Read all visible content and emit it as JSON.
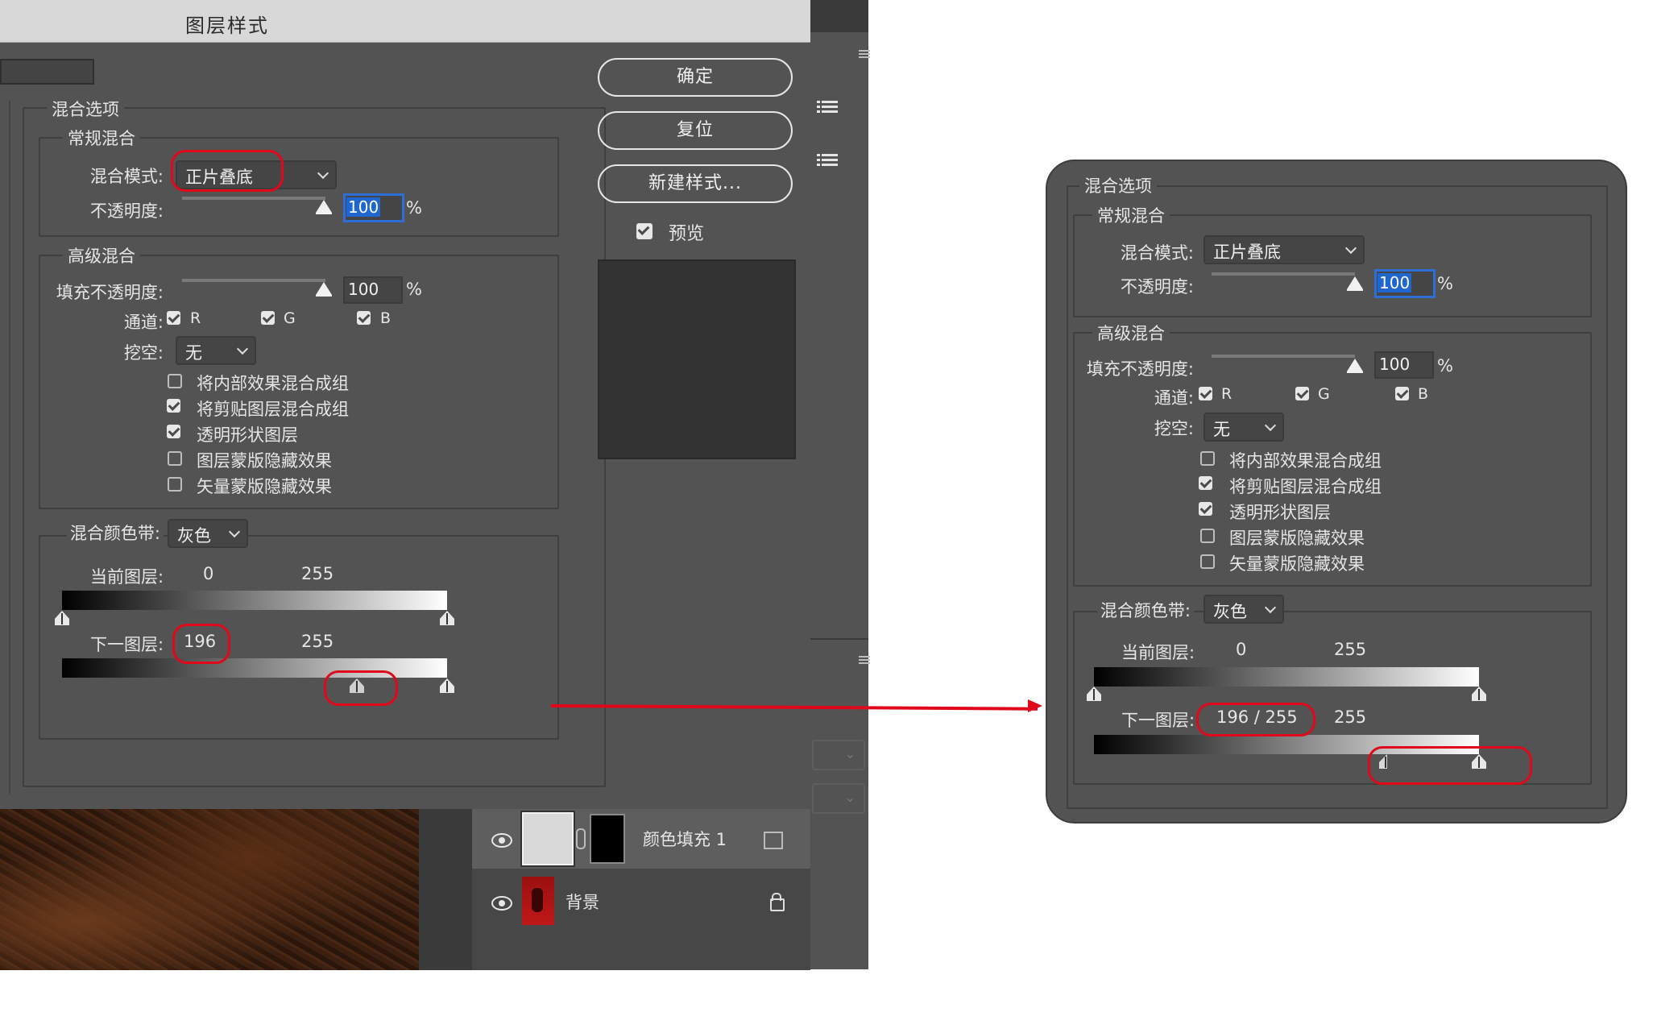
{
  "dialog": {
    "title": "图层样式",
    "buttons": {
      "ok": "确定",
      "reset": "复位",
      "new_style": "新建样式..."
    },
    "preview_label": "预览",
    "preview_checked": true
  },
  "blend_options": {
    "title": "混合选项",
    "general": {
      "title": "常规混合",
      "blend_mode_label": "混合模式:",
      "blend_mode": "正片叠底",
      "opacity_label": "不透明度:",
      "opacity": "100",
      "percent": "%"
    },
    "advanced": {
      "title": "高级混合",
      "fill_opacity_label": "填充不透明度:",
      "fill_opacity": "100",
      "percent": "%",
      "channels_label": "通道:",
      "channels": [
        "R",
        "G",
        "B"
      ],
      "knockout_label": "挖空:",
      "knockout": "无",
      "options": [
        {
          "label": "将内部效果混合成组",
          "checked": false
        },
        {
          "label": "将剪贴图层混合成组",
          "checked": true
        },
        {
          "label": "透明形状图层",
          "checked": true
        },
        {
          "label": "图层蒙版隐藏效果",
          "checked": false
        },
        {
          "label": "矢量蒙版隐藏效果",
          "checked": false
        }
      ]
    },
    "blend_if": {
      "label": "混合颜色带:",
      "value": "灰色",
      "this_layer_label": "当前图层:",
      "this_layer_black": "0",
      "this_layer_white": "255",
      "underlying_label": "下一图层:",
      "underlying_black": "196",
      "underlying_white": "255",
      "underlying_split": "196  /  255",
      "underlying_split_fraction": 0.769
    }
  },
  "layers": [
    {
      "name": "颜色填充 1",
      "visible": true,
      "selected": true
    },
    {
      "name": "背景",
      "visible": true,
      "locked": true
    }
  ],
  "colors": {
    "highlight": "#e0081a",
    "focus": "#1f66d1",
    "panel": "#535353"
  }
}
